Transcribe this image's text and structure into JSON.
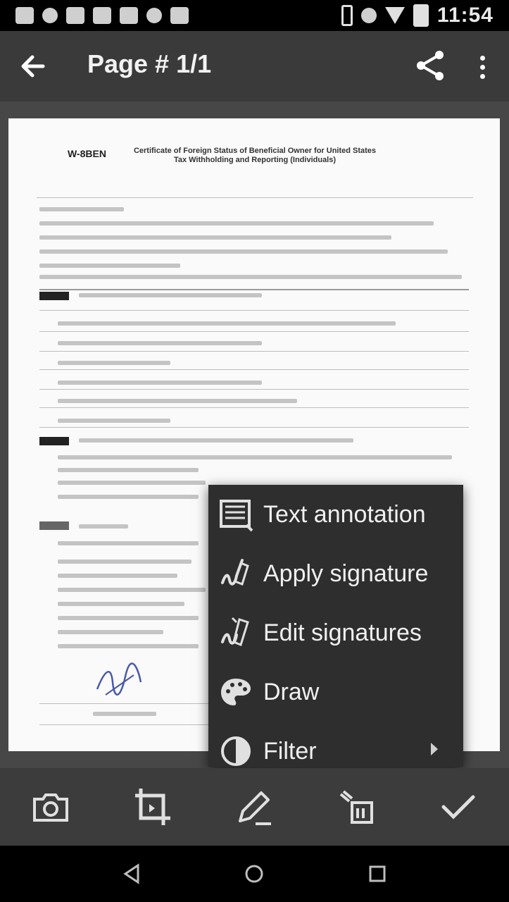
{
  "status_bar": {
    "time": "11:54",
    "icons": [
      "message-icon",
      "notification-icon",
      "photo-icon",
      "calendar-icon",
      "media-icon",
      "sync-icon",
      "video-icon",
      "vibrate-icon",
      "alarm-icon",
      "wifi-icon",
      "battery-icon"
    ]
  },
  "toolbar": {
    "title": "Page # 1/1",
    "back_icon": "back-arrow-icon",
    "share_icon": "share-icon",
    "more_icon": "more-vert-icon"
  },
  "document": {
    "form_id": "W-8BEN",
    "heading": "Certificate of Foreign Status of Beneficial Owner for United States Tax Withholding and Reporting (Individuals)"
  },
  "menu": {
    "items": [
      {
        "label": "Text annotation",
        "icon": "text-box-icon"
      },
      {
        "label": "Apply signature",
        "icon": "signature-icon"
      },
      {
        "label": "Edit signatures",
        "icon": "edit-signature-icon"
      },
      {
        "label": "Draw",
        "icon": "palette-icon"
      },
      {
        "label": "Filter",
        "icon": "contrast-icon",
        "has_submenu": true
      }
    ]
  },
  "bottom_toolbar": {
    "buttons": [
      "camera-icon",
      "crop-icon",
      "pencil-icon",
      "recolor-icon",
      "check-icon"
    ]
  },
  "nav_bar": {
    "buttons": [
      "nav-back-icon",
      "nav-home-icon",
      "nav-recents-icon"
    ]
  },
  "colors": {
    "toolbar": "#3a3a3a",
    "canvas": "#474747",
    "menu": "#2e2e2e",
    "page": "#fafafa"
  }
}
